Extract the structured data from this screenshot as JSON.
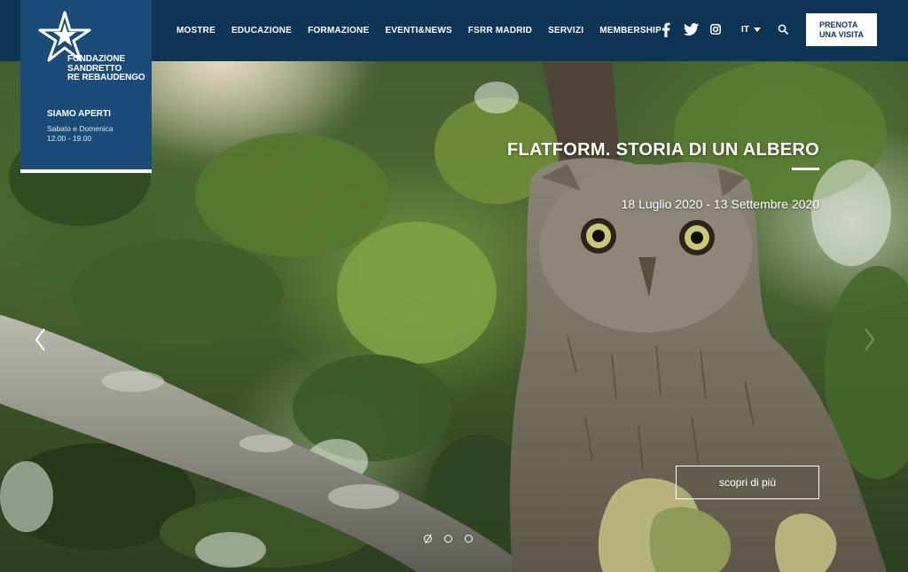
{
  "brand": {
    "name": "FONDAZIONE\nSANDRETTO\nRE REBAUDENGO",
    "hours_title": "SIAMO APERTI",
    "hours_text": "Sabato e Domenica\n12.00 - 19.00"
  },
  "nav": {
    "items": [
      "MOSTRE",
      "EDUCAZIONE",
      "FORMAZIONE",
      "EVENTI&NEWS",
      "FSRR MADRID",
      "SERVIZI",
      "MEMBERSHIP"
    ]
  },
  "header": {
    "social": [
      "facebook-icon",
      "twitter-icon",
      "instagram-icon"
    ],
    "language": "IT",
    "book_label": "PRENOTA\nUNA VISITA"
  },
  "slide": {
    "title": "FLATFORM. STORIA DI UN ALBERO",
    "dates": "18 Luglio 2020 - 13 Settembre 2020",
    "cta_label": "scopri di più",
    "slide_count": 3,
    "active_slide": 1
  },
  "colors": {
    "header_bg": "#0e3556",
    "logo_bg": "#1b4c79",
    "text": "#ffffff"
  }
}
